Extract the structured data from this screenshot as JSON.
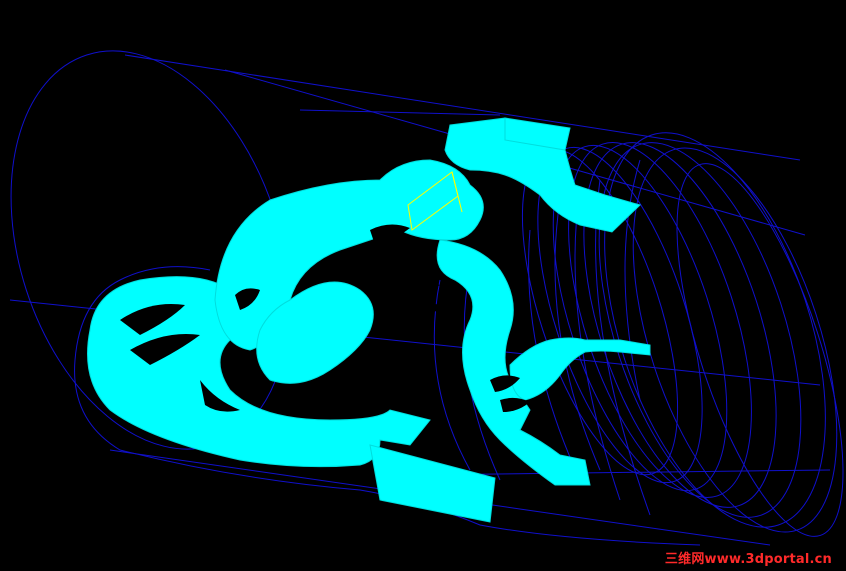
{
  "viewport": {
    "background_color": "#000000",
    "wireframe_color": "#1010cc",
    "part_color": "#00ffff",
    "selection_outline_color": "#ffff00"
  },
  "watermark": {
    "text": "三维网www.3dportal.cn",
    "color": "#ff2a2a"
  }
}
